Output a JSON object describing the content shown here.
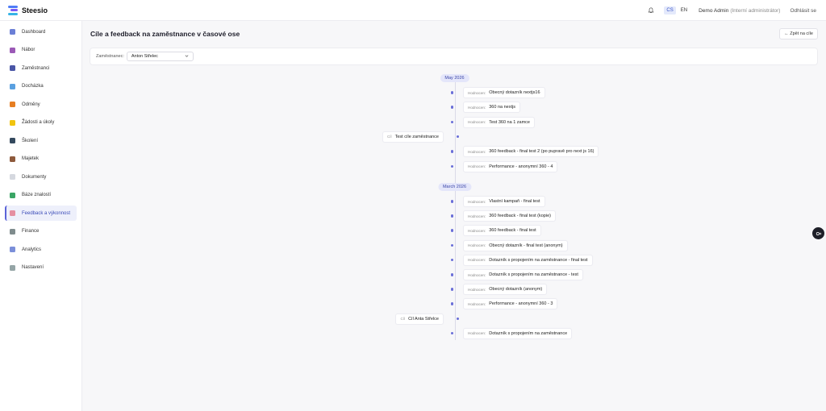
{
  "app": {
    "name": "Steesio"
  },
  "header": {
    "lang_cs": "CS",
    "lang_en": "EN",
    "user_name": "Demo Admin",
    "user_role": "(Interní administrátor)",
    "logout": "Odhlásit se"
  },
  "sidebar": {
    "items": [
      {
        "label": "Dashboard",
        "color": "#6b7fd6"
      },
      {
        "label": "Nábor",
        "color": "#9b59b6"
      },
      {
        "label": "Zaměstnanci",
        "color": "#4a56a6"
      },
      {
        "label": "Docházka",
        "color": "#5aa0e0"
      },
      {
        "label": "Odměny",
        "color": "#e67e22"
      },
      {
        "label": "Žádosti a úkoly",
        "color": "#f1c40f"
      },
      {
        "label": "Školení",
        "color": "#34495e"
      },
      {
        "label": "Majetek",
        "color": "#8e5a3c"
      },
      {
        "label": "Dokumenty",
        "color": "#d5d8df"
      },
      {
        "label": "Báze znalostí",
        "color": "#3aa565"
      },
      {
        "label": "Feedback a výkonnost",
        "color": "#e58fa1"
      },
      {
        "label": "Finance",
        "color": "#7f8c8d"
      },
      {
        "label": "Analytics",
        "color": "#7b8fd9"
      },
      {
        "label": "Nastavení",
        "color": "#95a5a6"
      }
    ],
    "active_index": 10
  },
  "page": {
    "title": "Cíle a feedback na zaměstnance v časové ose",
    "back_button": "← Zpět na cíle",
    "filter_label": "Zaměstnanec:",
    "employee_value": "Anton Střelec"
  },
  "timeline": {
    "months": [
      "May 2026",
      "March 2026"
    ],
    "prefix_feedback": "Hodnocen:",
    "prefix_goal": "Cíl",
    "may_items": [
      {
        "kind": "feedback",
        "text": "Obecný dotazník nextjs16"
      },
      {
        "kind": "feedback",
        "text": "360 na nextjs"
      },
      {
        "kind": "feedback",
        "text": "Test 360 na 1 zamce"
      },
      {
        "kind": "goal",
        "text": "Test cíle zaměstnance"
      },
      {
        "kind": "feedback",
        "text": "360 feedback - final test 2 (po pupravě pro next js 16)"
      },
      {
        "kind": "feedback",
        "text": "Performance - anonymní 360 - 4"
      }
    ],
    "march_items": [
      {
        "kind": "feedback",
        "text": "Vlastní kampaň - final test"
      },
      {
        "kind": "feedback",
        "text": "360 feedback - final test (kopie)"
      },
      {
        "kind": "feedback",
        "text": "360 feedback - final test"
      },
      {
        "kind": "feedback",
        "text": "Obecný dotazník - final test (anonym)"
      },
      {
        "kind": "feedback",
        "text": "Dotazník s propojením na zaměstnance - final test"
      },
      {
        "kind": "feedback",
        "text": "Dotazník s propojením na zaměstnance - test"
      },
      {
        "kind": "feedback",
        "text": "Obecný dotazník (anonym)"
      },
      {
        "kind": "feedback",
        "text": "Performance - anonymní 360 - 3"
      },
      {
        "kind": "goal",
        "text": "Cíl Anta Střelce"
      },
      {
        "kind": "feedback",
        "text": "Dotazník s propojením na zaměstnance"
      }
    ]
  },
  "colors": {
    "accent": "#5a63d8",
    "timeline_dot": "#6a6ed8",
    "month_badge_bg": "#e4e6fa"
  }
}
